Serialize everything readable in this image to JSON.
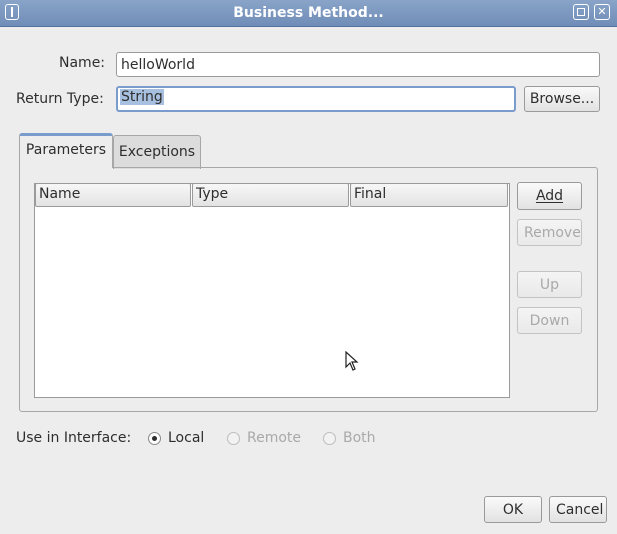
{
  "window": {
    "title": "Business Method..."
  },
  "form": {
    "name_label": "Name:",
    "name_value": "helloWorld",
    "return_type_label": "Return Type:",
    "return_type_value": "String",
    "browse_label": "Browse..."
  },
  "tabs": [
    {
      "label": "Parameters",
      "active": true
    },
    {
      "label": "Exceptions",
      "active": false
    }
  ],
  "table": {
    "columns": [
      "Name",
      "Type",
      "Final"
    ],
    "rows": []
  },
  "side_buttons": {
    "add": "Add",
    "remove": "Remove",
    "up": "Up",
    "down": "Down"
  },
  "interface": {
    "label": "Use in Interface:",
    "options": [
      {
        "label": "Local",
        "checked": true,
        "enabled": true
      },
      {
        "label": "Remote",
        "checked": false,
        "enabled": false
      },
      {
        "label": "Both",
        "checked": false,
        "enabled": false
      }
    ]
  },
  "footer": {
    "ok": "OK",
    "cancel": "Cancel"
  },
  "colors": {
    "titlebar": "#7a97c0",
    "focus_border": "#7a9ccc",
    "selection": "#a8c0e0",
    "window_bg": "#ededed"
  }
}
